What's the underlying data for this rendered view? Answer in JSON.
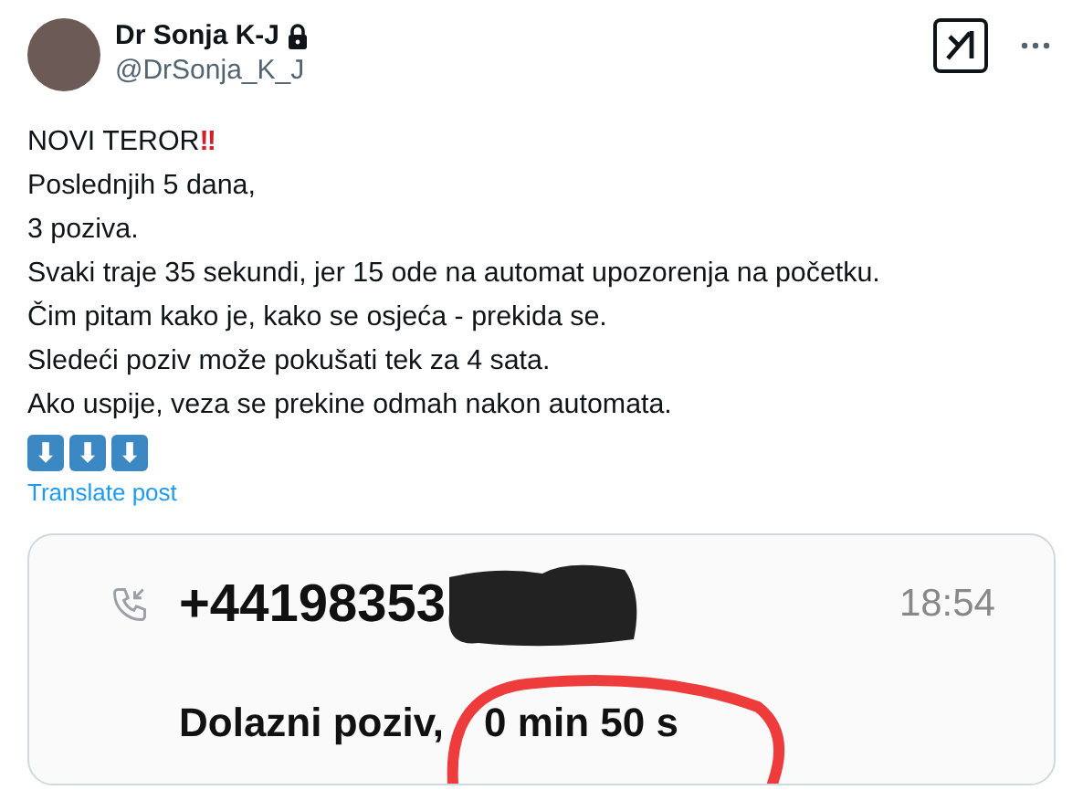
{
  "author": {
    "name": "Dr Sonja K-J",
    "handle": "@DrSonja_K_J",
    "protected": true
  },
  "headline": {
    "text": "NOVI TEROR",
    "mark": "‼"
  },
  "lines": [
    "Poslednjih 5 dana,",
    "3 poziva.",
    "Svaki traje 35 sekundi, jer 15 ode na automat upozorenja na početku.",
    "Čim pitam kako je, kako se osjeća - prekida se.",
    "Sledeći poziv može pokušati tek za 4 sata.",
    "Ako uspije, veza se prekine odmah nakon automata."
  ],
  "arrow_emojis": [
    "⬇",
    "⬇",
    "⬇"
  ],
  "translate_link": "Translate post",
  "attached_image": {
    "number": "+44198353",
    "time": "18:54",
    "call_type": "Dolazni poziv,",
    "duration": "0 min 50 s"
  }
}
